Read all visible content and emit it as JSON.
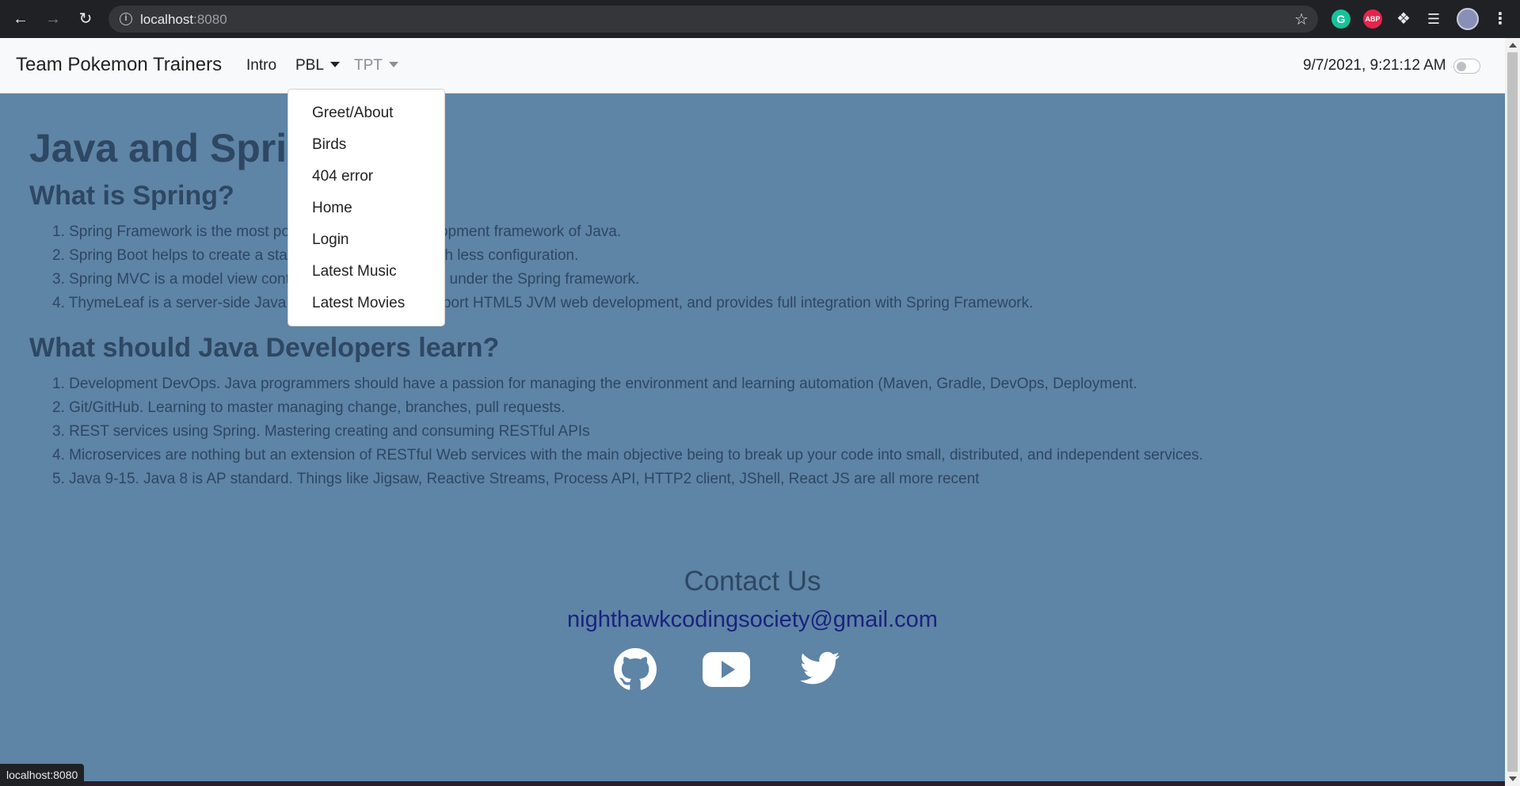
{
  "browser": {
    "url_host": "localhost",
    "url_port": ":8080",
    "status_url": "localhost:8080",
    "extensions": [
      "grammarly-icon",
      "adblock-plus-icon",
      "puzzle-icon",
      "reading-list-icon",
      "profile-avatar",
      "kebab-menu-icon"
    ],
    "abp_label": "ABP",
    "grammarly_label": "G"
  },
  "navbar": {
    "brand": "Team Pokemon Trainers",
    "links": {
      "intro": "Intro",
      "pbl": "PBL",
      "tpt": "TPT"
    },
    "datetime": "9/7/2021, 9:21:12 AM",
    "theme_toggle_on": false
  },
  "dropdown": {
    "items": [
      "Greet/About",
      "Birds",
      "404 error",
      "Home",
      "Login",
      "Latest Music",
      "Latest Movies"
    ]
  },
  "main": {
    "title": "Java and Spring",
    "section1": {
      "heading": "What is Spring?",
      "items": [
        "1. Spring Framework is the most popular application development framework of Java.",
        "2. Spring Boot helps to create a stand-alone application with less configuration.",
        "3. Spring MVC is a model view controller (MVC) framework under the Spring framework.",
        "4. ThymeLeaf is a server-side Java template engine to support HTML5 JVM web development, and provides full integration with Spring Framework."
      ]
    },
    "section2": {
      "heading": "What should Java Developers learn?",
      "items": [
        "1. Development DevOps. Java programmers should have a passion for managing the environment and learning automation (Maven, Gradle, DevOps, Deployment.",
        "2. Git/GitHub. Learning to master managing change, branches, pull requests.",
        "3. REST services using Spring. Mastering creating and consuming RESTful APIs",
        "4. Microservices are nothing but an extension of RESTful Web services with the main objective being to break up your code into small, distributed, and independent services.",
        "5. Java 9-15. Java 8 is AP standard. Things like Jigsaw, Reactive Streams, Process API, HTTP2 client, JShell, React JS are all more recent"
      ]
    }
  },
  "contact": {
    "title": "Contact Us",
    "email": "nighthawkcodingsociety@gmail.com",
    "social_icons": [
      "github-icon",
      "youtube-icon",
      "twitter-icon"
    ]
  },
  "colors": {
    "page_background": "#5e84a6",
    "text": "#2e4762",
    "email_link": "#1a237e",
    "navbar_background": "#f8f9fa"
  }
}
